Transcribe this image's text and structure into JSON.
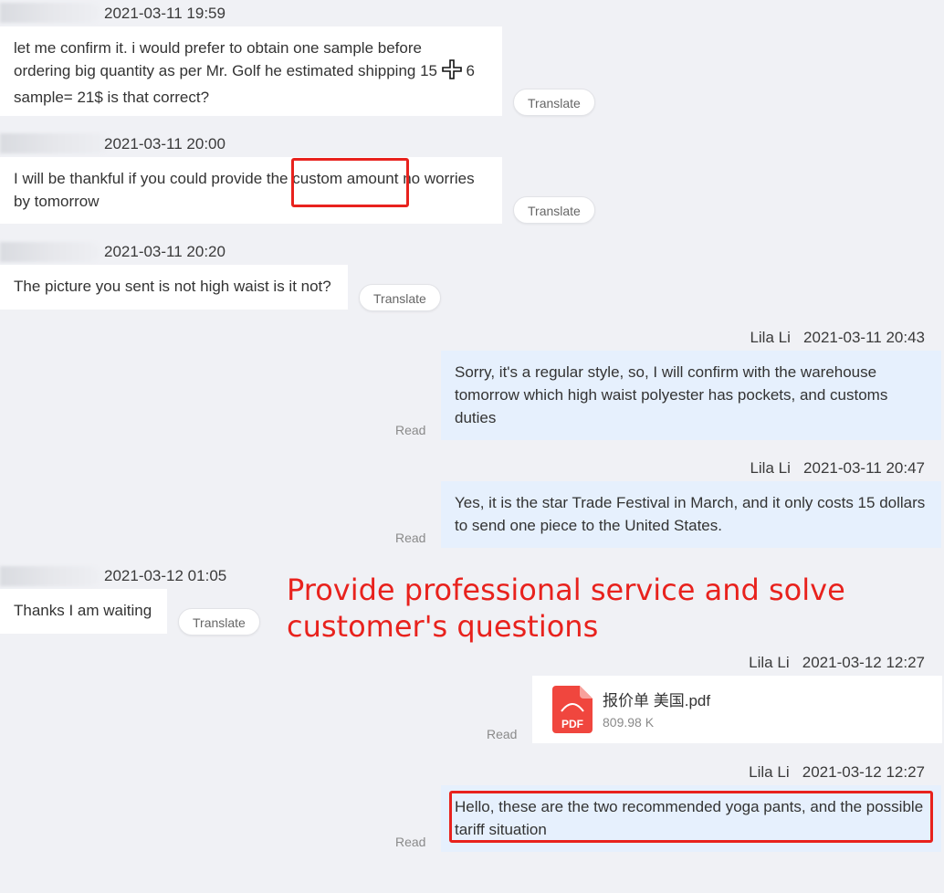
{
  "messages": [
    {
      "time": "2021-03-11 19:59",
      "lines": [
        "let me confirm it. i would prefer to obtain one sample before",
        "ordering big quantity as per Mr. Golf he estimated shipping 15 ",
        " 6",
        "sample= 21$ is that correct?"
      ],
      "translate": "Translate"
    },
    {
      "time": "2021-03-11 20:00",
      "line1_before": "I will be thankful if you could provide the ",
      "line1_highlight": "custom amount",
      "line1_after": " no worries",
      "line2": "by tomorrow",
      "translate": "Translate"
    },
    {
      "time": "2021-03-11 20:20",
      "text": "The picture you sent is not high waist is it not?",
      "translate": "Translate"
    },
    {
      "sender": "Lila Li",
      "time": "2021-03-11 20:43",
      "text": "Sorry, it's a regular style, so, I will confirm with the warehouse tomorrow which high waist polyester has pockets, and customs duties",
      "status": "Read"
    },
    {
      "sender": "Lila Li",
      "time": "2021-03-11 20:47",
      "text": "Yes, it is the star Trade Festival in March, and it only costs 15 dollars to send one piece to the United States.",
      "status": "Read"
    },
    {
      "time": "2021-03-12 01:05",
      "text": "Thanks I am waiting",
      "translate": "Translate"
    },
    {
      "sender": "Lila Li",
      "time": "2021-03-12 12:27",
      "file_name": "报价单 美国.pdf",
      "file_size": "809.98 K",
      "file_icon_label": "PDF",
      "status": "Read"
    },
    {
      "sender": "Lila Li",
      "time": "2021-03-12 12:27",
      "text": "Hello, these are the two recommended yoga pants, and the possible tariff situation",
      "status": "Read"
    }
  ],
  "annotation": "Provide professional service and solve customer's questions",
  "colors": {
    "background": "#f0f1f5",
    "outgoing_bubble": "#e6f0fd",
    "incoming_bubble": "#ffffff",
    "annotation_red": "#e8221d"
  },
  "icons": {
    "cursor": "move-cursor-icon",
    "file": "pdf-file-icon"
  }
}
